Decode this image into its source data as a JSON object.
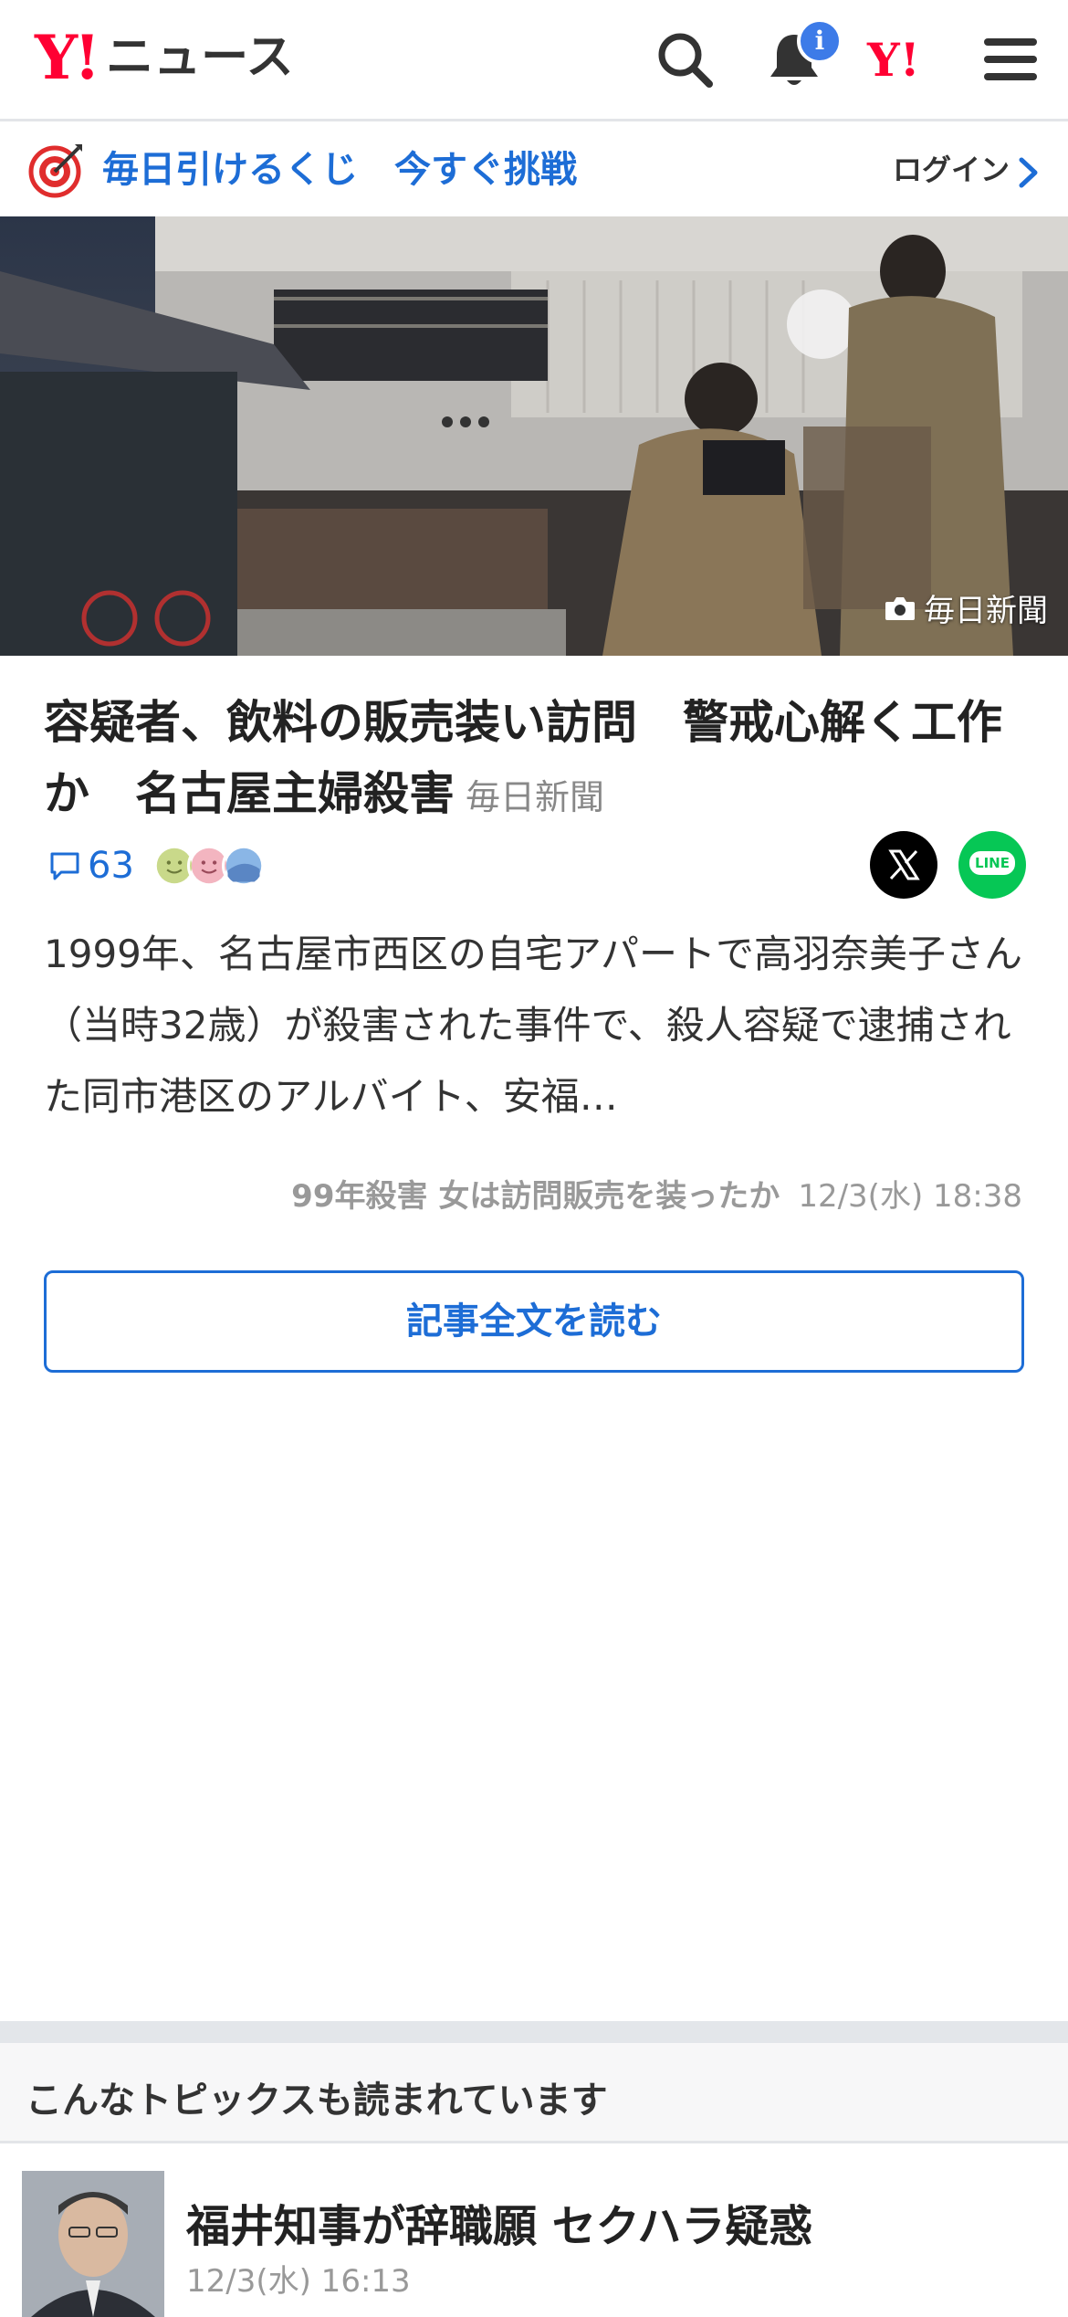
{
  "header": {
    "logo_mark": "Y!",
    "logo_text": "ニュース",
    "notification_badge": "i",
    "yahoo_mark": "Y!"
  },
  "promo": {
    "text": "毎日引けるくじ　今すぐ挑戦",
    "login_label": "ログイン"
  },
  "hero": {
    "credit": "毎日新聞"
  },
  "article": {
    "title": "容疑者、飲料の販売装い訪問　警戒心解く工作か　名古屋主婦殺害",
    "source": "毎日新聞",
    "comment_count": "63",
    "summary": "1999年、名古屋市西区の自宅アパートで高羽奈美子さん（当時32歳）が殺害された事件で、殺人容疑で逮捕された同市港区のアルバイト、安福…",
    "related_headline": "99年殺害 女は訪問販売を装ったか",
    "related_time": "12/3(水) 18:38",
    "read_more_label": "記事全文を読む"
  },
  "share": {
    "x_label": "X",
    "line_label": "LINE"
  },
  "topics": {
    "heading": "こんなトピックスも読まれています",
    "items": [
      {
        "title": "福井知事が辞職願 セクハラ疑惑",
        "time": "12/3(水) 16:13"
      }
    ]
  },
  "colors": {
    "brand_red": "#ff0033",
    "link_blue": "#1d6dd6",
    "line_green": "#06c755"
  }
}
